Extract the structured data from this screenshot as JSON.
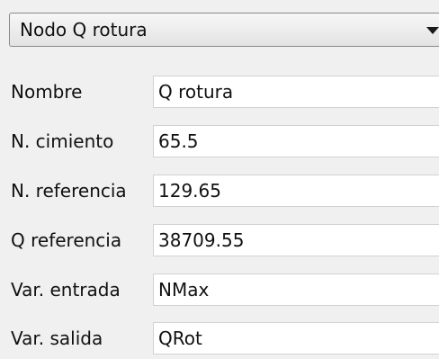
{
  "selector": {
    "value": "Nodo Q rotura"
  },
  "icons": {
    "combo_arrow": "chevron-down-icon"
  },
  "fields": [
    {
      "label": "Nombre",
      "value": "Q rotura"
    },
    {
      "label": "N. cimiento",
      "value": "65.5"
    },
    {
      "label": "N. referencia",
      "value": "129.65"
    },
    {
      "label": "Q referencia",
      "value": "38709.55"
    },
    {
      "label": "Var. entrada",
      "value": "NMax"
    },
    {
      "label": "Var. salida",
      "value": "QRot"
    }
  ]
}
